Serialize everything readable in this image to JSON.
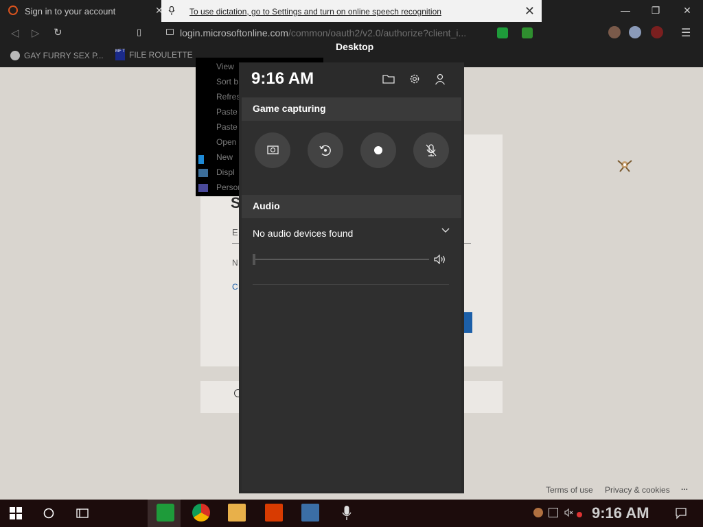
{
  "browser": {
    "tab_title": "Sign in to your account",
    "url_main": "login.microsoftonline.com",
    "url_rest": "/common/oauth2/v2.0/authorize?client_i...",
    "bookmarks": [
      {
        "label": "GAY FURRY SEX P..."
      },
      {
        "label": "FILE ROULETTE"
      }
    ],
    "mft_badge": "MF T"
  },
  "dictation": {
    "message": "To use dictation, go to Settings and turn on online speech recognition"
  },
  "context_menu": {
    "items": [
      "View",
      "Sort b",
      "Refres",
      "Paste",
      "Paste",
      "Open",
      "New",
      "Displ",
      "Persor"
    ]
  },
  "page": {
    "fragments": [
      "S",
      "E",
      "N",
      "C"
    ],
    "footer_links": [
      "Terms of use",
      "Privacy & cookies",
      "..."
    ]
  },
  "gamebar": {
    "window_title": "Desktop",
    "time": "9:16 AM",
    "capture_section": "Game capturing",
    "audio_section": "Audio",
    "audio_device": "No audio devices found"
  },
  "taskbar": {
    "clock": "9:16 AM"
  },
  "colors": {
    "accent_blue": "#1c5fa8",
    "gamebar_bg": "#2b2b2b",
    "taskbar_bg": "#1c0c0c"
  }
}
